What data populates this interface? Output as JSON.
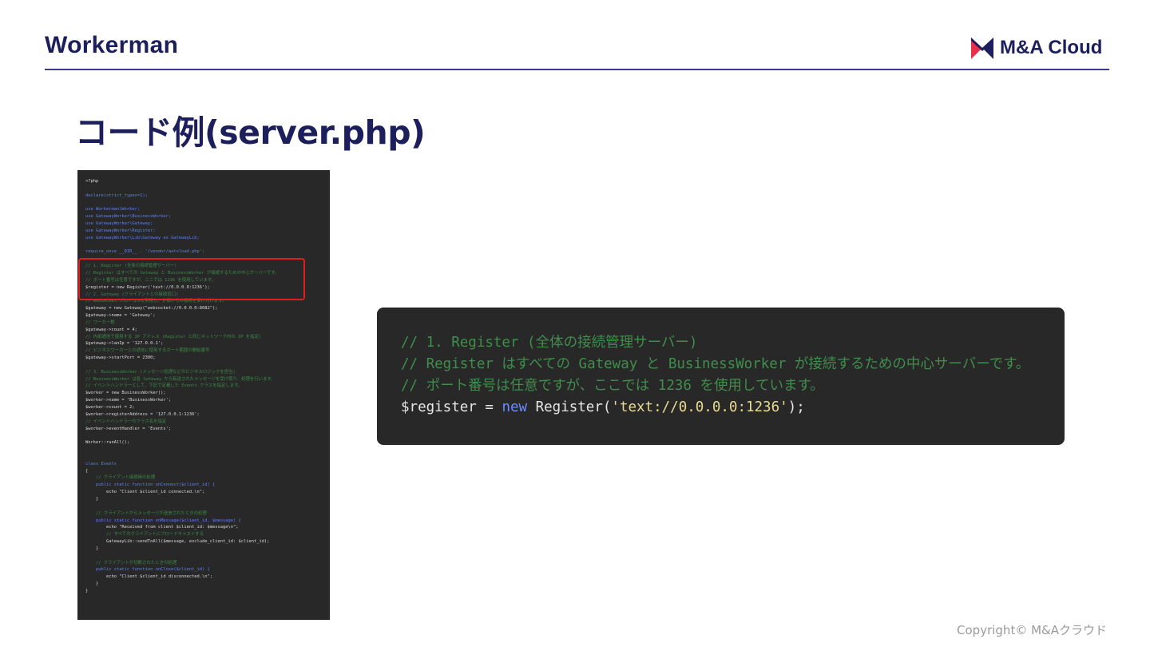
{
  "header": {
    "title": "Workerman",
    "logo_text": "M&A Cloud",
    "brand_color": "#1c1f5c",
    "logo_accent_color": "#e8304a"
  },
  "slide_title": "コード例(server.php)",
  "full_code": {
    "lines": [
      "<?php",
      "",
      "declare(strict_types=1);",
      "",
      "use Workerman\\Worker;",
      "use GatewayWorker\\BusinessWorker;",
      "use GatewayWorker\\Gateway;",
      "use GatewayWorker\\Register;",
      "use GatewayWorker\\Lib\\Gateway as GatewayLib;",
      "",
      "require_once __DIR__ . '/vendor/autoload.php';",
      "",
      "// 1. Register (全体の接続管理サーバー)",
      "// Register はすべての Gateway と BusinessWorker が接続するための中心サーバーです。",
      "// ポート番号は任意ですが、ここでは 1236 を使用しています。",
      "$register = new Register('text://0.0.0.0:1236');",
      "// 2. Gateway (クライアントとの接続窓口)",
      "// WebSocket プロトコルを利用し、外部からの接続を受け付けます。",
      "$gateway = new Gateway(\"websocket://0.0.0.0:8082\");",
      "$gateway->name = 'Gateway';",
      "// ワーカー数",
      "$gateway->count = 4;",
      "// 内部通信で使用する IP アドレス (Register と同じネットワーク内の IP を指定)",
      "$gateway->lanIp = '127.0.0.1';",
      "// ビジネスワーカーとの通信に使用するポート範囲の開始番号",
      "$gateway->startPort = 2300;",
      "",
      "// 3. BusinessWorker (メッセージ処理などのビジネスロジックを担当)",
      "// BusinessWorker は各 Gateway から転送されたメッセージを受け取り、処理を行います。",
      "// イベントハンドラーとして、下記で定義した Events クラスを指定します。",
      "$worker = new BusinessWorker();",
      "$worker->name = 'BusinessWorker';",
      "$worker->count = 2;",
      "$worker->registerAddress = '127.0.0.1:1236';",
      "// イベントハンドラーのクラス名を指定",
      "$worker->eventHandler = 'Events';",
      "",
      "Worker::runAll();",
      "",
      "",
      "class Events",
      "{",
      "    // クライアント接続時の処理",
      "    public static function onConnect($client_id) {",
      "        echo \"Client $client_id connected.\\n\";",
      "    }",
      "",
      "    // クライアントからメッセージが送信されたときの処理",
      "    public static function onMessage($client_id, $message) {",
      "        echo \"Received from client $client_id: $message\\n\";",
      "        // すべてのクライアントにブロードキャストする",
      "        GatewayLib::sendToAll($message, exclude_client_id: $client_id);",
      "    }",
      "",
      "    // クライアントが切断されたときの処理",
      "    public static function onClose($client_id) {",
      "        echo \"Client $client_id disconnected.\\n\";",
      "    }",
      "}"
    ]
  },
  "zoom_code": {
    "comment_1": "// 1. Register (全体の接続管理サーバー)",
    "comment_2": "// Register はすべての Gateway と BusinessWorker が接続するための中心サーバーです。",
    "comment_3": "// ポート番号は任意ですが、ここでは 1236 を使用しています。",
    "code_var": "$register = ",
    "code_kw": "new",
    "code_call": " Register(",
    "code_str": "'text://0.0.0.0:1236'",
    "code_end": ");"
  },
  "copyright": "Copyright© M&Aクラウド"
}
